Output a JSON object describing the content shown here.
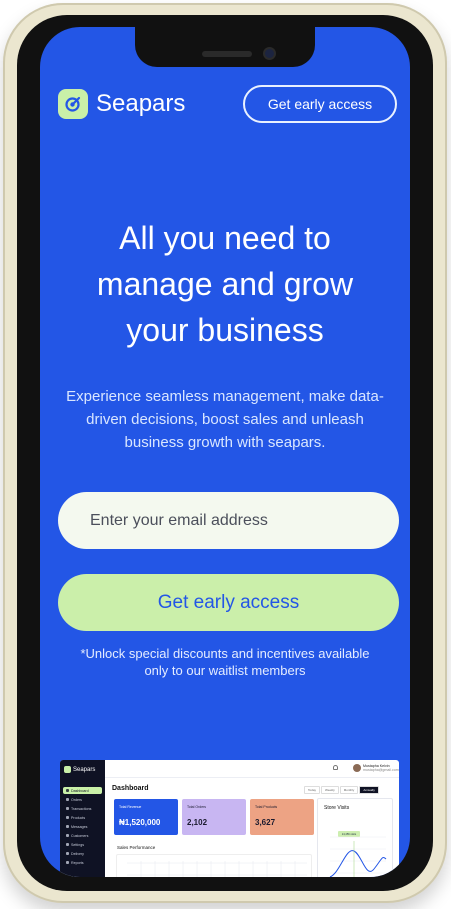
{
  "brand": {
    "name": "Seapars",
    "accent": "#2356e6",
    "lime": "#cbefaa"
  },
  "nav": {
    "cta_label": "Get early access"
  },
  "hero": {
    "title_lines": [
      "All you need to",
      "manage and grow",
      "your business"
    ],
    "subtitle_lines": [
      "Experience seamless management, make data-",
      "driven decisions, boost sales and unleash",
      "business growth with seapars."
    ]
  },
  "form": {
    "email_placeholder": "Enter your email address",
    "submit_label": "Get early access",
    "note_lines": [
      "*Unlock special discounts and incentives available",
      "only to our waitlist members"
    ]
  },
  "dashboard_preview": {
    "brand": "Seapars",
    "title": "Dashboard",
    "nav_items": [
      "Dashboard",
      "Orders",
      "Transactions",
      "Products",
      "Messages",
      "Customers",
      "Settings",
      "Delivery",
      "Reports"
    ],
    "filters": [
      "Today",
      "Weekly",
      "Monthly",
      "Annually"
    ],
    "user": {
      "name": "Mustapha Kelvin",
      "email": "mustapha@gmail.com"
    },
    "stats": [
      {
        "label": "Total Revenue",
        "value": "₦1,520,000"
      },
      {
        "label": "Total Orders",
        "value": "2,102"
      },
      {
        "label": "Total Products",
        "value": "3,627"
      }
    ],
    "sales_title": "Sales Performance",
    "visits_title": "Store Visits",
    "visits_tooltip": "14,456 visits"
  }
}
